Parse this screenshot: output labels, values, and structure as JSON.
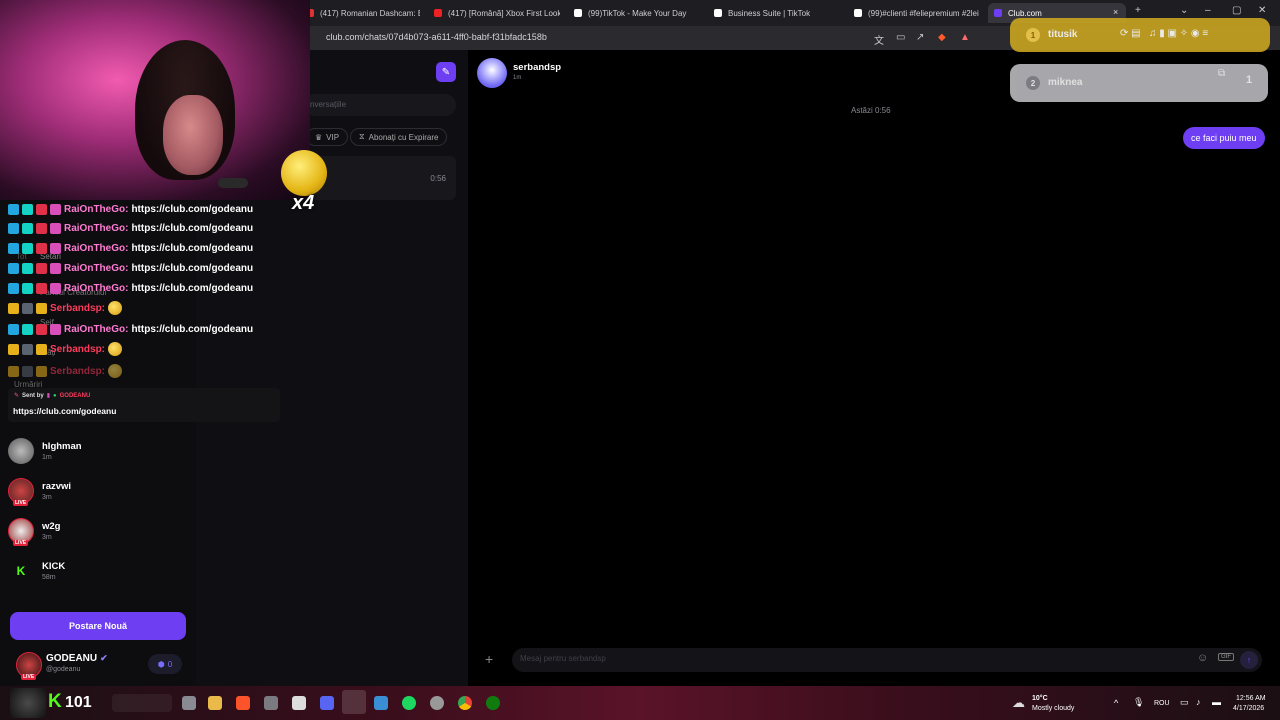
{
  "browser": {
    "tabs": [
      {
        "title": "(417) Romanian Dashcam: Biciclis",
        "fav": "#d33"
      },
      {
        "title": "(417) [Română] Xbox First Look:",
        "fav": "#e22"
      },
      {
        "title": "(99)TikTok - Make Your Day",
        "fav": "#fff"
      },
      {
        "title": "Business Suite | TikTok",
        "fav": "#fff"
      },
      {
        "title": "(99)#clienti #feliepremium #2lei",
        "fav": "#fff"
      },
      {
        "title": "Club.com",
        "fav": "#6d3ef2"
      }
    ],
    "new_tab": "+",
    "tab_close": "×",
    "url": "club.com/chats/07d4b073-a611-4ff0-babf-f31bfadc158b"
  },
  "overlay": {
    "emote_count": "x4",
    "chat_rows": [
      {
        "user": "RaiOnTheGo:",
        "msg": "https://club.com/godeanu",
        "style": "pink"
      },
      {
        "user": "RaiOnTheGo:",
        "msg": "https://club.com/godeanu",
        "style": "pink"
      },
      {
        "user": "RaiOnTheGo:",
        "msg": "https://club.com/godeanu",
        "style": "pink"
      },
      {
        "user": "RaiOnTheGo:",
        "msg": "https://club.com/godeanu",
        "style": "pink"
      },
      {
        "user": "Serbandsp:",
        "msg": "",
        "style": "red"
      },
      {
        "user": "RaiOnTheGo:",
        "msg": "https://club.com/godeanu",
        "style": "pink"
      },
      {
        "user": "Serbandsp:",
        "msg": "",
        "style": "red"
      },
      {
        "user": "Serbandsp:",
        "msg": "",
        "style": "red"
      }
    ],
    "sent_by_label": "Sent by",
    "sent_by_user": "GODEANU",
    "sent_by_link": "https://club.com/godeanu",
    "kick_count": "101"
  },
  "sidebar_faded": [
    "Tot",
    "Setări",
    "Panoul Creatorului",
    "Seif",
    "Plăți",
    "Urmăriri"
  ],
  "middle": {
    "search_placeholder": "nversațiile",
    "filter_vip": "VIP",
    "filter_subs": "Abonați cu Expirare",
    "conversation_time": "0:56"
  },
  "chat_list": [
    {
      "name": "hIghman",
      "time": "1m",
      "live": false
    },
    {
      "name": "razvwi",
      "time": "3m",
      "live": true
    },
    {
      "name": "w2g",
      "time": "3m",
      "live": true
    },
    {
      "name": "KICK",
      "time": "58m",
      "live": false
    }
  ],
  "new_post_label": "Postare Nouă",
  "profile": {
    "name": "GODEANU",
    "handle": "@godeanu",
    "count": "0",
    "live_label": "LIVE"
  },
  "chat": {
    "partner_name": "serbandsp",
    "partner_status": "1m",
    "date_separator": "Astăzi 0:56",
    "message": "ce faci puiu meu",
    "input_placeholder": "Mesaj pentru serbandsp",
    "gif_label": "GIF"
  },
  "notifications": [
    {
      "rank": "1",
      "name": "titusik"
    },
    {
      "rank": "2",
      "name": "miknea",
      "count": "1"
    }
  ],
  "taskbar": {
    "weather_temp": "10°C",
    "weather_desc": "Mostly cloudy",
    "lang": "ROU",
    "time": "12:56 AM",
    "date": "4/17/2026"
  }
}
